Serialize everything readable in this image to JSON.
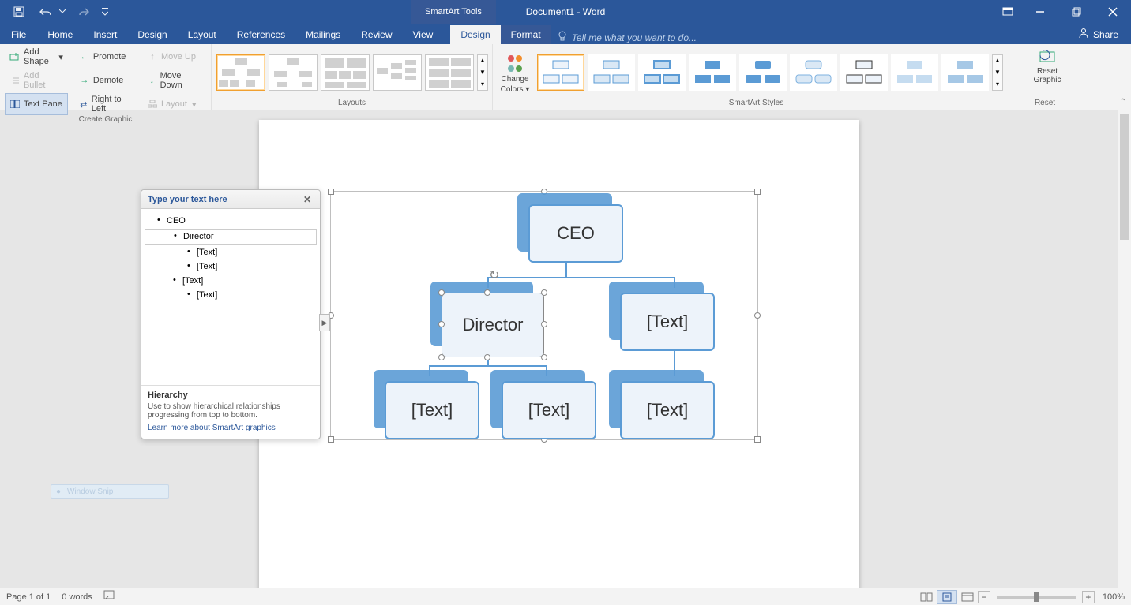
{
  "titlebar": {
    "smartart_tools": "SmartArt Tools",
    "document_title": "Document1 - Word"
  },
  "tabs": {
    "file": "File",
    "home": "Home",
    "insert": "Insert",
    "design_doc": "Design",
    "layout": "Layout",
    "references": "References",
    "mailings": "Mailings",
    "review": "Review",
    "view": "View",
    "design": "Design",
    "format": "Format",
    "tell_me": "Tell me what you want to do...",
    "share": "Share"
  },
  "ribbon": {
    "create_graphic": {
      "label": "Create Graphic",
      "add_shape": "Add Shape",
      "add_bullet": "Add Bullet",
      "text_pane": "Text Pane",
      "promote": "Promote",
      "demote": "Demote",
      "right_to_left": "Right to Left",
      "move_up": "Move Up",
      "move_down": "Move Down",
      "layout_btn": "Layout"
    },
    "layouts": {
      "label": "Layouts"
    },
    "change_colors": {
      "line1": "Change",
      "line2": "Colors"
    },
    "smartart_styles": {
      "label": "SmartArt Styles"
    },
    "reset": {
      "line1": "Reset",
      "line2": "Graphic",
      "group": "Reset"
    }
  },
  "text_pane": {
    "header": "Type your text here",
    "items": [
      {
        "text": "CEO",
        "indent": 0
      },
      {
        "text": "Director",
        "indent": 1,
        "selected": true
      },
      {
        "text": "[Text]",
        "indent": 2
      },
      {
        "text": "[Text]",
        "indent": 2
      },
      {
        "text": "[Text]",
        "indent": 0
      },
      {
        "text": "[Text]",
        "indent": 2
      }
    ],
    "info_title": "Hierarchy",
    "info_body": "Use to show hierarchical relationships progressing from top to bottom.",
    "info_link": "Learn more about SmartArt graphics"
  },
  "smartart": {
    "nodes": {
      "ceo": "CEO",
      "director": "Director",
      "text_right": "[Text]",
      "text_bl1": "[Text]",
      "text_bl2": "[Text]",
      "text_br": "[Text]"
    }
  },
  "window_snip": "Window Snip",
  "statusbar": {
    "page": "Page 1 of 1",
    "words": "0 words",
    "zoom": "100%"
  }
}
